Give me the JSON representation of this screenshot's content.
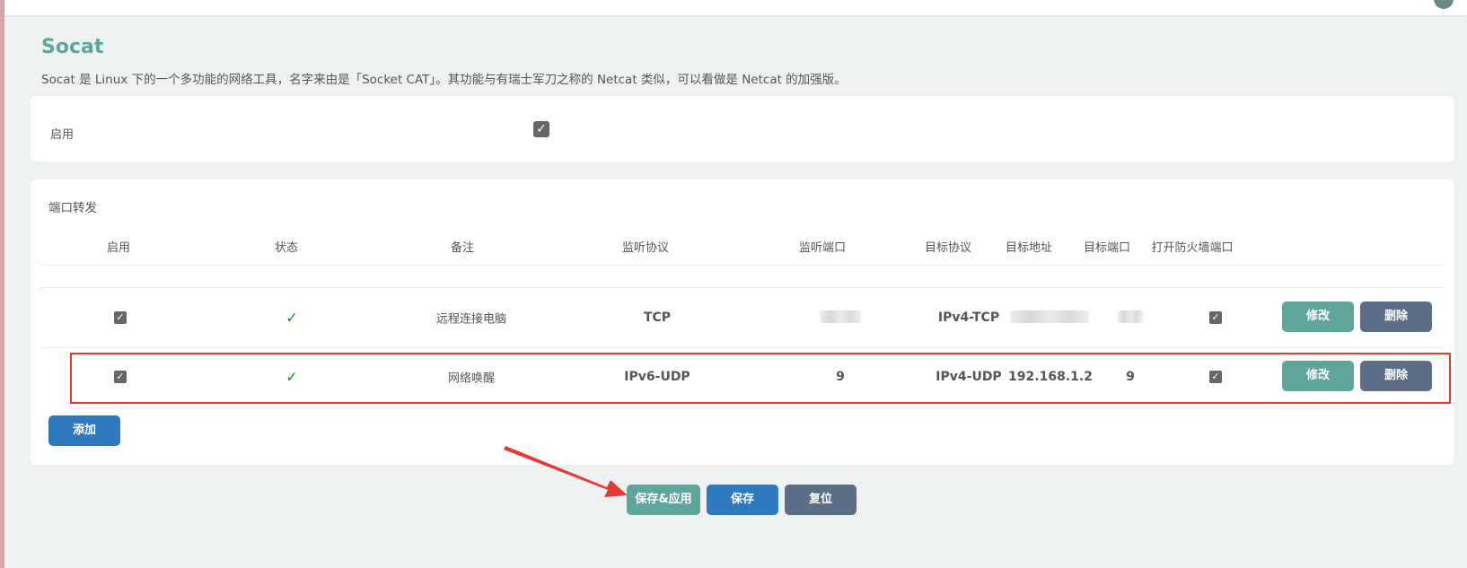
{
  "header": {
    "title": "Socat",
    "description": "Socat 是 Linux 下的一个多功能的网络工具，名字来由是「Socket CAT」。其功能与有瑞士军刀之称的 Netcat 类似，可以看做是 Netcat 的加强版。"
  },
  "enable_section": {
    "label": "启用",
    "checked": true
  },
  "port_forward": {
    "title": "端口转发",
    "columns": [
      "启用",
      "状态",
      "备注",
      "监听协议",
      "监听端口",
      "目标协议",
      "目标地址",
      "目标端口",
      "打开防火墙端口"
    ],
    "rows": [
      {
        "enabled": true,
        "status": "✓",
        "note": "远程连接电脑",
        "listen_protocol": "TCP",
        "listen_port": "",
        "target_protocol": "IPv4-TCP",
        "target_address": "",
        "target_port": "",
        "open_firewall": true,
        "edit_label": "修改",
        "delete_label": "删除"
      },
      {
        "enabled": true,
        "status": "✓",
        "note": "网络唤醒",
        "listen_protocol": "IPv6-UDP",
        "listen_port": "9",
        "target_protocol": "IPv4-UDP",
        "target_address": "192.168.1.2",
        "target_port": "9",
        "open_firewall": true,
        "edit_label": "修改",
        "delete_label": "删除"
      }
    ],
    "add_label": "添加"
  },
  "footer": {
    "save_apply_label": "保存&应用",
    "save_label": "保存",
    "reset_label": "复位"
  },
  "colors": {
    "accent": "#5fa59b",
    "slate": "#5c6e85",
    "blue": "#2f7abf",
    "annotation": "#e53935"
  }
}
